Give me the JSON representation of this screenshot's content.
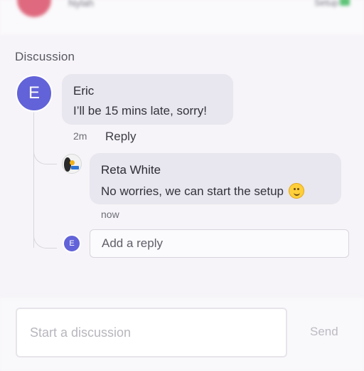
{
  "header": {
    "name": "Nylah",
    "status": "Setup"
  },
  "discussion": {
    "title": "Discussion",
    "comment": {
      "avatar_initial": "E",
      "author": "Eric",
      "message": "I’ll be 15 mins late, sorry!",
      "time": "2m",
      "reply_label": "Reply"
    },
    "reply": {
      "author": "Reta White",
      "message": "No worries, we can start the setup",
      "emoji": "smiling-face-icon",
      "time": "now"
    },
    "reply_input": {
      "avatar_initial": "E",
      "placeholder": "Add a reply"
    }
  },
  "composer": {
    "placeholder": "Start a discussion",
    "send_label": "Send"
  },
  "colors": {
    "accent": "#6263d8",
    "bubble": "#e8e6ee",
    "background": "#f6f4f8"
  }
}
